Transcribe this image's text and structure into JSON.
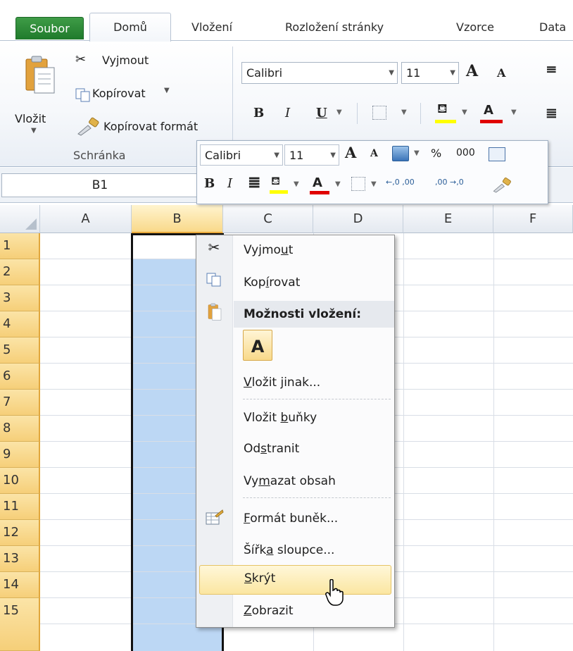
{
  "ribbon_tabs": {
    "file": "Soubor",
    "home": "Domů",
    "insert": "Vložení",
    "page_layout": "Rozložení stránky",
    "formulas": "Vzorce",
    "data": "Data"
  },
  "clipboard": {
    "paste_label": "Vložit",
    "cut_label": "Vyjmout",
    "copy_label": "Kopírovat",
    "format_painter_label": "Kopírovat formát",
    "group_label": "Schránka"
  },
  "font": {
    "name": "Calibri",
    "size": "11",
    "grow_label": "A",
    "shrink_label": "A",
    "bold": "B",
    "italic": "I",
    "underline": "U",
    "font_color_label": "A"
  },
  "name_box": {
    "value": "B1"
  },
  "grid": {
    "columns": [
      "A",
      "B",
      "C",
      "D",
      "E",
      "F"
    ],
    "rows": [
      "1",
      "2",
      "3",
      "4",
      "5",
      "6",
      "7",
      "8",
      "9",
      "10",
      "11",
      "12",
      "13",
      "14",
      "15"
    ],
    "selected_column": "B"
  },
  "mini_toolbar": {
    "font_name": "Calibri",
    "font_size": "11",
    "percent": "%",
    "thousands": "000",
    "bold": "B",
    "italic": "I",
    "font_color_label": "A",
    "increase_decimal": "←,0 ,00",
    "decrease_decimal": ",00 →,0"
  },
  "context_menu": {
    "cut": {
      "pre": "Vyjmo",
      "u": "u",
      "post": "t"
    },
    "copy": {
      "pre": "Kop",
      "u": "í",
      "post": "rovat"
    },
    "paste_options_header": "Možnosti vložení:",
    "paste_values_icon_label": "A",
    "paste_special": {
      "pre": "",
      "u": "V",
      "post": "ložit jinak..."
    },
    "insert_cells": {
      "pre": "Vložit ",
      "u": "b",
      "post": "uňky"
    },
    "delete": {
      "pre": "Od",
      "u": "s",
      "post": "tranit"
    },
    "clear_contents": {
      "pre": "Vy",
      "u": "m",
      "post": "azat obsah"
    },
    "format_cells": {
      "pre": "",
      "u": "F",
      "post": "ormát buněk..."
    },
    "column_width": {
      "pre": "Šířk",
      "u": "a",
      "post": " sloupce..."
    },
    "hide": {
      "pre": "",
      "u": "S",
      "post": "krýt"
    },
    "unhide": {
      "pre": "",
      "u": "Z",
      "post": "obrazit"
    }
  },
  "colors": {
    "file_tab": "#1f7a2b",
    "selection": "#bcd7f4",
    "row_header": "#f6cf79",
    "menu_hover": "#fbe6a1",
    "highlight_yellow": "#ffff00",
    "font_red": "#e00000"
  }
}
